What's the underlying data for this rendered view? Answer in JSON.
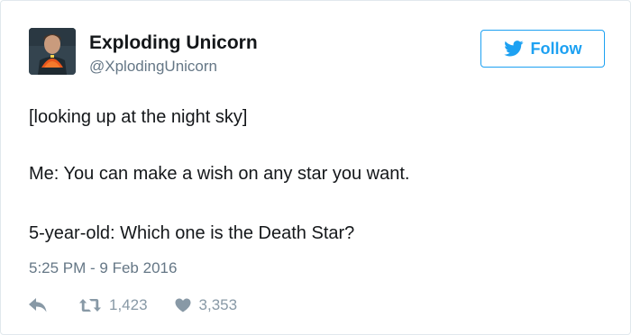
{
  "tweet": {
    "author": {
      "display_name": "Exploding Unicorn",
      "handle": "@XplodingUnicorn"
    },
    "follow_button": {
      "label": "Follow",
      "icon": "twitter-bird-icon"
    },
    "text_lines": [
      "[looking up at the night sky]",
      "Me: You can make a wish on any star you want.",
      "5-year-old: Which one is the Death Star?"
    ],
    "timestamp": "5:25 PM - 9 Feb 2016",
    "actions": {
      "reply": {
        "icon": "reply-icon"
      },
      "retweet": {
        "icon": "retweet-icon",
        "count": "1,423"
      },
      "like": {
        "icon": "heart-icon",
        "count": "3,353"
      }
    }
  },
  "colors": {
    "accent": "#1da1f2",
    "text_primary": "#14171a",
    "text_secondary": "#657786",
    "icon_gray": "#8899a6",
    "border": "#e1e8ed"
  }
}
